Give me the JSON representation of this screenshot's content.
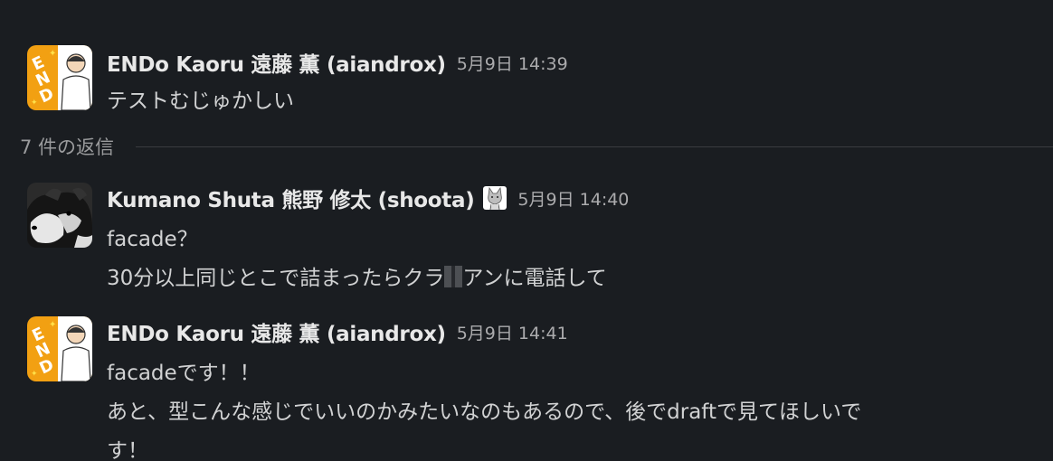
{
  "parent": {
    "name": "ENDo Kaoru 遠藤 薫 (aiandrox)",
    "timestamp": "5月9日 14:39",
    "text": "テストむじゅかしい"
  },
  "replies_label": "7 件の返信",
  "replies": [
    {
      "name": "Kumano Shuta 熊野 修太 (shoota)",
      "timestamp": "5月9日 14:40",
      "lines": [
        "facade？",
        "30分以上同じとこで詰まったらクラ",
        "アンに電話して"
      ]
    },
    {
      "name": "ENDo Kaoru 遠藤 薫 (aiandrox)",
      "timestamp": "5月9日 14:41",
      "lines": [
        "facadeです！！",
        "あと、型こんな感じでいいのかみたいなのもあるので、後でdraftで見てほしいで",
        "す！"
      ]
    }
  ],
  "colors": {
    "background": "#1a1d21",
    "text": "#d1d2d3",
    "muted": "#ababad",
    "avatar_orange": "#f2a012"
  },
  "icons": {
    "endo_avatar": "endo-logo-avatar",
    "kumano_avatar": "dog-photo-avatar",
    "status": "cat-status-emoji"
  }
}
